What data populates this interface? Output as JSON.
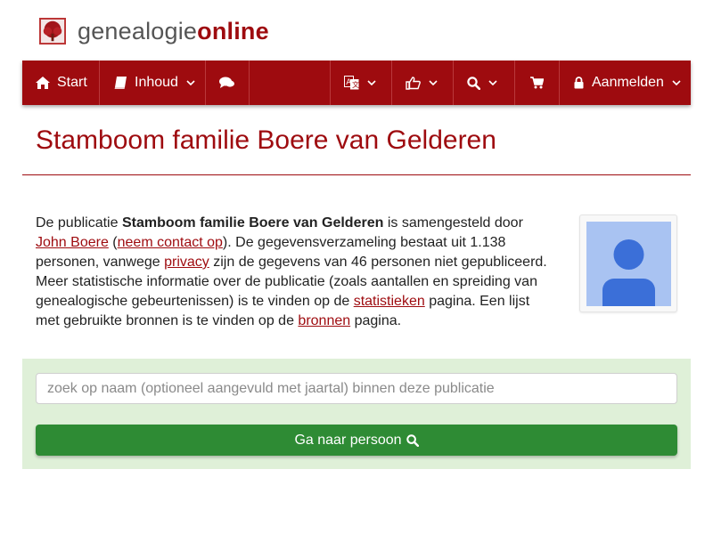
{
  "logo": {
    "part1": "genealogie",
    "part2": "online"
  },
  "nav": {
    "start_label": "Start",
    "inhoud_label": "Inhoud",
    "login_label": "Aanmelden",
    "icons": [
      "home-icon",
      "book-icon",
      "comments-icon",
      "language-icon",
      "thumbs-up-icon",
      "search-icon",
      "cart-icon",
      "lock-icon"
    ]
  },
  "page": {
    "title": "Stamboom familie Boere van Gelderen"
  },
  "description": {
    "t1": "De publicatie ",
    "pub_name": "Stamboom familie Boere van Gelderen",
    "t2": " is samengesteld door ",
    "author": "John Boere",
    "t3": " (",
    "contact": "neem contact op",
    "t4": "). De gegevensverzameling bestaat uit 1.138 personen, vanwege ",
    "privacy": "privacy",
    "t5": " zijn de gegevens van 46 personen niet gepubliceerd. Meer statistische informatie over de publicatie (zoals aantallen en spreiding van genealogische gebeurtenissen) is te vinden op de ",
    "stats": "statistieken",
    "t6": " pagina. Een lijst met gebruikte bronnen is te vinden op de ",
    "sources": "bronnen",
    "t7": " pagina."
  },
  "search": {
    "placeholder": "zoek op naam (optioneel aangevuld met jaartal) binnen deze publicatie",
    "button_label": "Ga naar persoon"
  },
  "colors": {
    "brand": "#9e0b0f",
    "panel": "#dff0d8",
    "button": "#2e8b34",
    "avatar": "#a9c3f2",
    "avatar_figure": "#3b6fd8"
  }
}
